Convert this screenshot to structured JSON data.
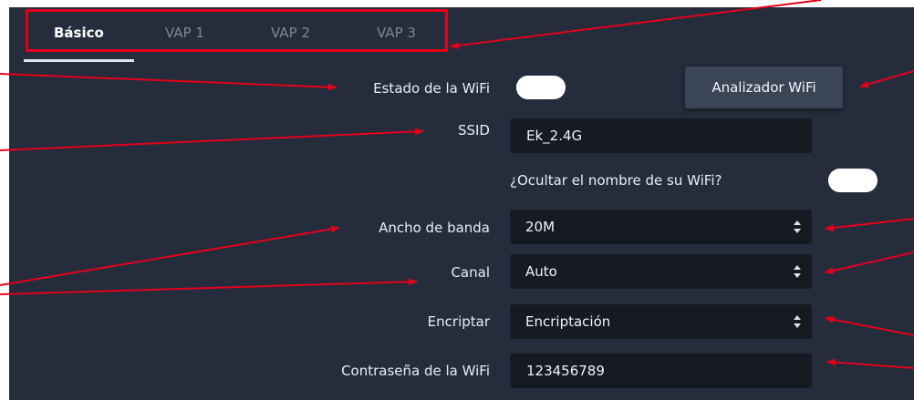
{
  "tabs": [
    {
      "label": "Básico",
      "active": true
    },
    {
      "label": "VAP 1",
      "active": false
    },
    {
      "label": "VAP 2",
      "active": false
    },
    {
      "label": "VAP 3",
      "active": false
    }
  ],
  "wifi_status": {
    "label": "Estado de la WiFi",
    "enabled": true
  },
  "analyzer_button": {
    "label": "Analizador WiFi"
  },
  "ssid": {
    "label": "SSID",
    "value": "Ek_2.4G"
  },
  "hide_ssid": {
    "label": "¿Ocultar el nombre de su WiFi?",
    "enabled": true
  },
  "bandwidth": {
    "label": "Ancho de banda",
    "value": "20M"
  },
  "channel": {
    "label": "Canal",
    "value": "Auto"
  },
  "encryption": {
    "label": "Encriptar",
    "value": "Encriptación"
  },
  "password": {
    "label": "Contraseña de la WiFi",
    "value": "123456789"
  },
  "colors": {
    "panel": "#252d3d",
    "field": "#161a21",
    "annotation": "#e4001a",
    "button": "#3b4558"
  }
}
